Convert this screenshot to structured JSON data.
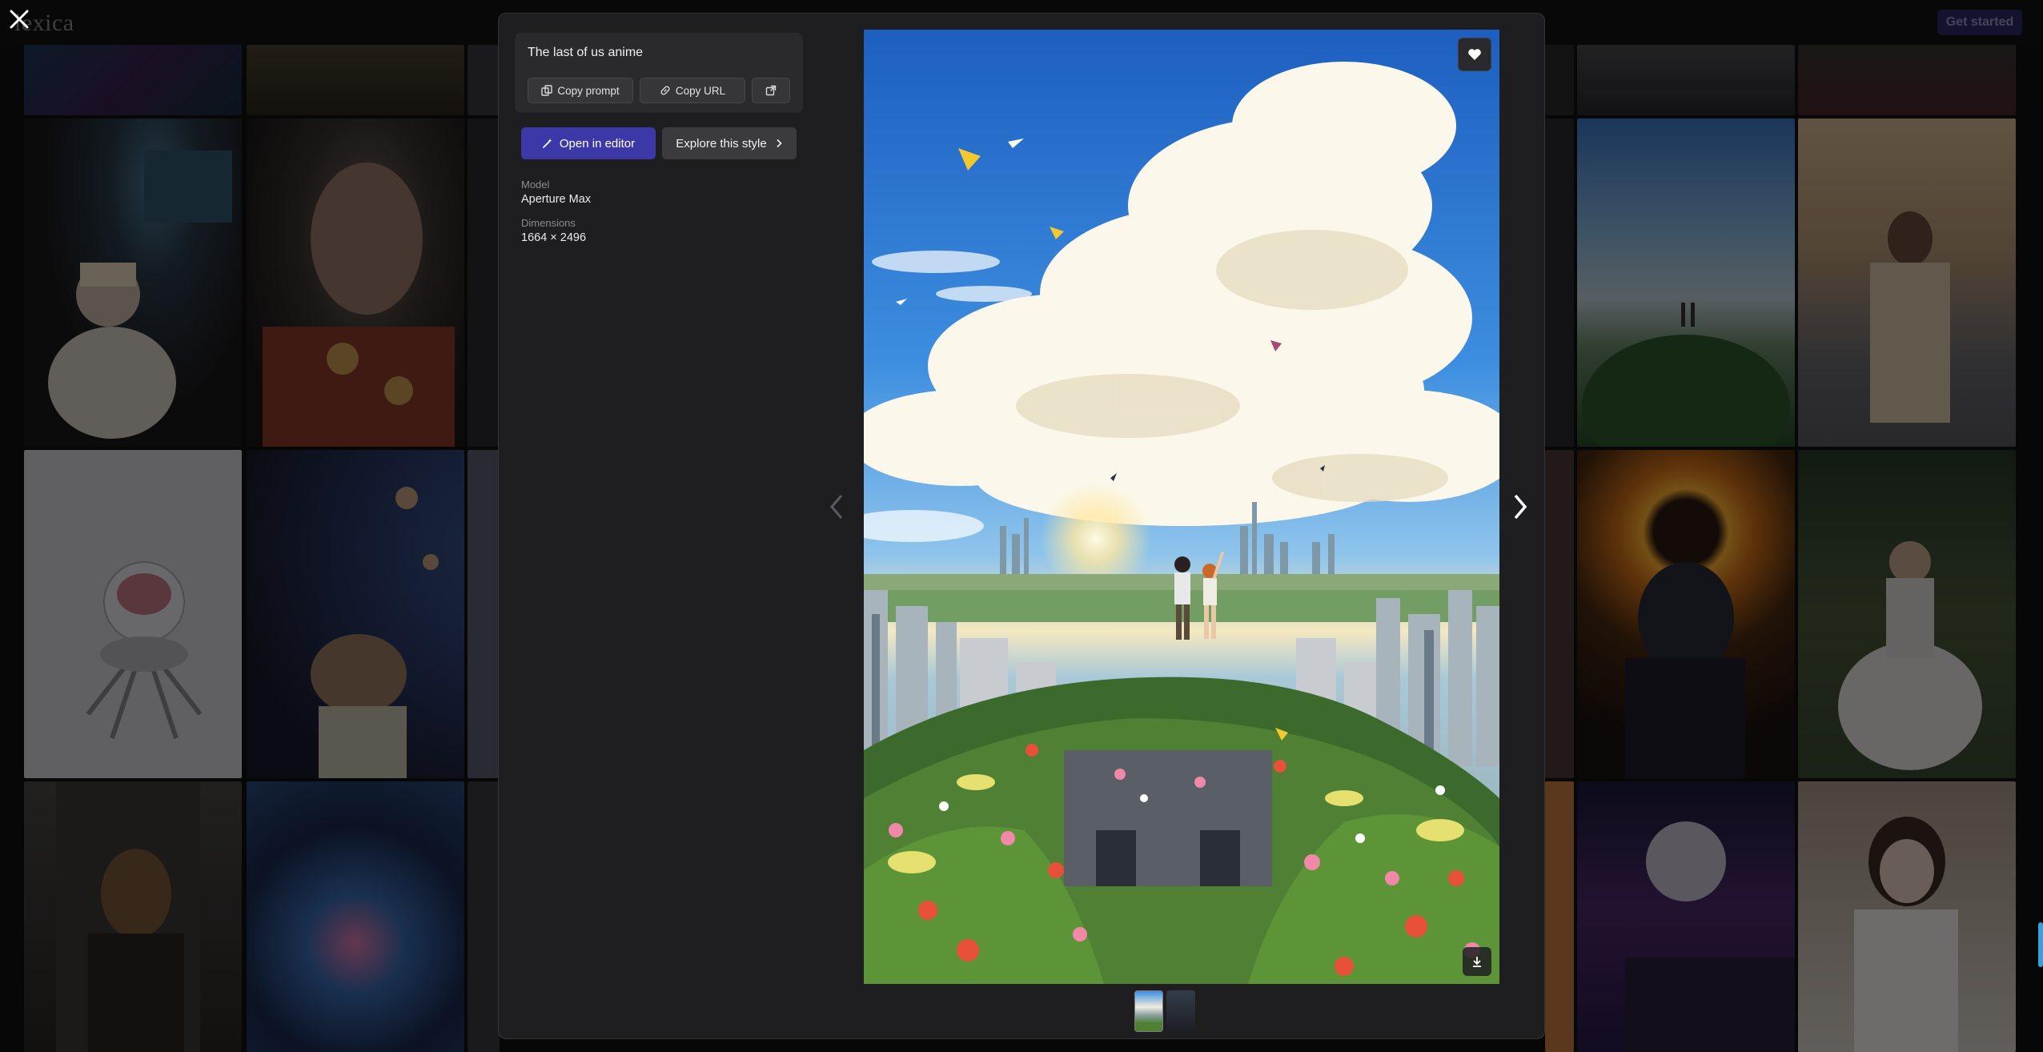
{
  "site": {
    "brand": "lexica",
    "get_started": "Get started"
  },
  "modal": {
    "prompt": "The last of us anime",
    "actions": {
      "copy_prompt": "Copy prompt",
      "copy_url": "Copy URL"
    },
    "open_in_editor": "Open in editor",
    "explore_style": "Explore this style",
    "model_label": "Model",
    "model_value": "Aperture Max",
    "dimensions_label": "Dimensions",
    "dimensions_value": "1664 × 2496"
  },
  "icons": {
    "close": "close-icon",
    "copy": "copy-icon",
    "link": "link-icon",
    "external": "external-link-icon",
    "wand": "magic-wand-icon",
    "chevron": "chevron-right-icon",
    "heart": "heart-icon",
    "download": "download-icon",
    "prev": "chevron-left-icon",
    "next": "chevron-right-icon"
  },
  "colors": {
    "primary": "#3d38a8",
    "modal_bg": "#1e1e21",
    "card_bg": "#2a2a2e",
    "page_bg": "#101013"
  }
}
